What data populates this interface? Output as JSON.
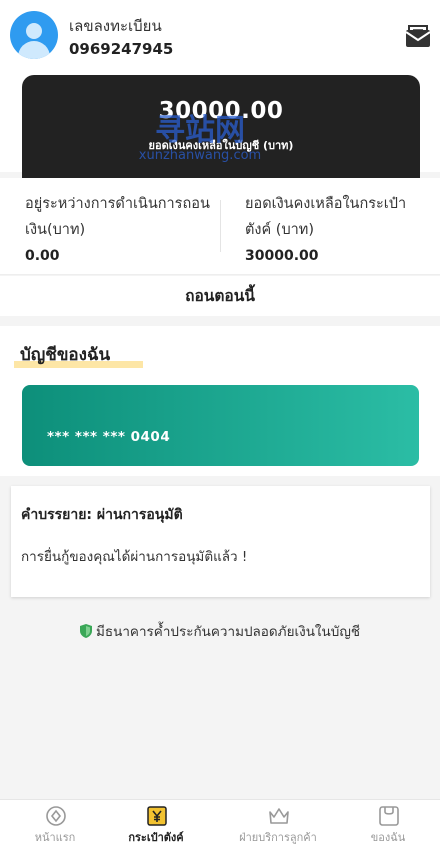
{
  "user": {
    "label": "เลขลงทะเบียน",
    "phone": "0969247945"
  },
  "icons": {
    "avatar": "user-avatar-icon",
    "mail": "mail-envelope-icon",
    "shield": "shield-icon"
  },
  "balance": {
    "amount": "30000.00",
    "label": "ยอดเงินคงเหลือในบัญชี (บาท)"
  },
  "watermark": {
    "line1": "寻站网",
    "line2": "xunzhanwang.com"
  },
  "stats": {
    "pending_label": "อยู่ระหว่างการดำเนินการถอนเงิน(บาท)",
    "pending_value": "0.00",
    "wallet_label": "ยอดเงินคงเหลือในกระเป๋าตังค์ (บาท)",
    "wallet_value": "30000.00"
  },
  "withdraw_label": "ถอนตอนนี้",
  "accounts": {
    "title": "บัญชีของฉัน",
    "card_number": "*** *** *** 0404"
  },
  "description": {
    "title": "คำบรรยาย:  ผ่านการอนุมัติ",
    "text": "การยื่นกู้ของคุณได้ผ่านการอนุมัติแล้ว !"
  },
  "guarantee_text": "มีธนาคารค้ำประกันความปลอดภัยเงินในบัญชี",
  "tabs": [
    {
      "label": "หน้าแรก",
      "icon": "home-icon",
      "active": false
    },
    {
      "label": "กระเป๋าตังค์",
      "icon": "wallet-icon",
      "active": true
    },
    {
      "label": "ฝ่ายบริการลูกค้า",
      "icon": "crown-icon",
      "active": false
    },
    {
      "label": "ของฉัน",
      "icon": "profile-icon",
      "active": false
    }
  ],
  "colors": {
    "card_dark": "#222222",
    "bank_card_start": "#0d8f7a",
    "bank_card_end": "#2bbda5",
    "highlight": "#fde6a6",
    "active_tab": "#f2c230",
    "shield": "#3aa757"
  }
}
